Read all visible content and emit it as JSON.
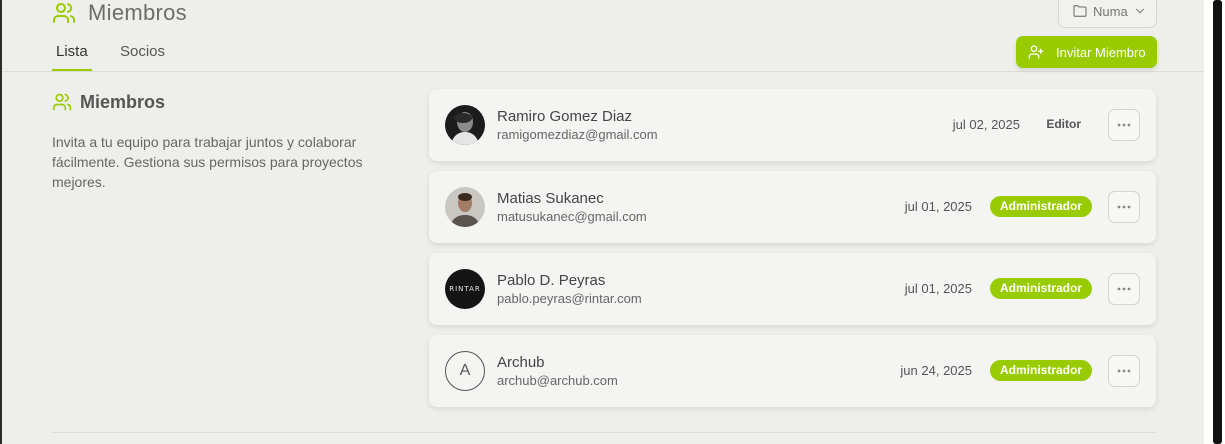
{
  "header": {
    "title": "Miembros",
    "project_selector": "Numa",
    "tabs": [
      {
        "label": "Lista",
        "active": true
      },
      {
        "label": "Socios",
        "active": false
      }
    ],
    "invite_button": "Invitar Miembro"
  },
  "section": {
    "title": "Miembros",
    "description": "Invita a tu equipo para trabajar juntos y colaborar fácilmente. Gestiona sus permisos para proyectos mejores."
  },
  "members": [
    {
      "name": "Ramiro Gomez Diaz",
      "email": "ramigomezdiaz@gmail.com",
      "date": "jul 02, 2025",
      "role": "Editor"
    },
    {
      "name": "Matias Sukanec",
      "email": "matusukanec@gmail.com",
      "date": "jul 01, 2025",
      "role": "Administrador"
    },
    {
      "name": "Pablo D. Peyras",
      "email": "pablo.peyras@rintar.com",
      "date": "jul 01, 2025",
      "role": "Administrador",
      "avatar_text": "RINTAR"
    },
    {
      "name": "Archub",
      "email": "archub@archub.com",
      "date": "jun 24, 2025",
      "role": "Administrador",
      "avatar_initial": "A"
    }
  ],
  "colors": {
    "accent": "#99cc00",
    "background": "#eeeeeb",
    "card": "#f4f4f2"
  },
  "icons": {
    "title": "users-icon",
    "project": "folder-icon",
    "dropdown": "chevron-down-icon",
    "invite": "user-plus-icon",
    "more": "ellipsis-icon"
  }
}
